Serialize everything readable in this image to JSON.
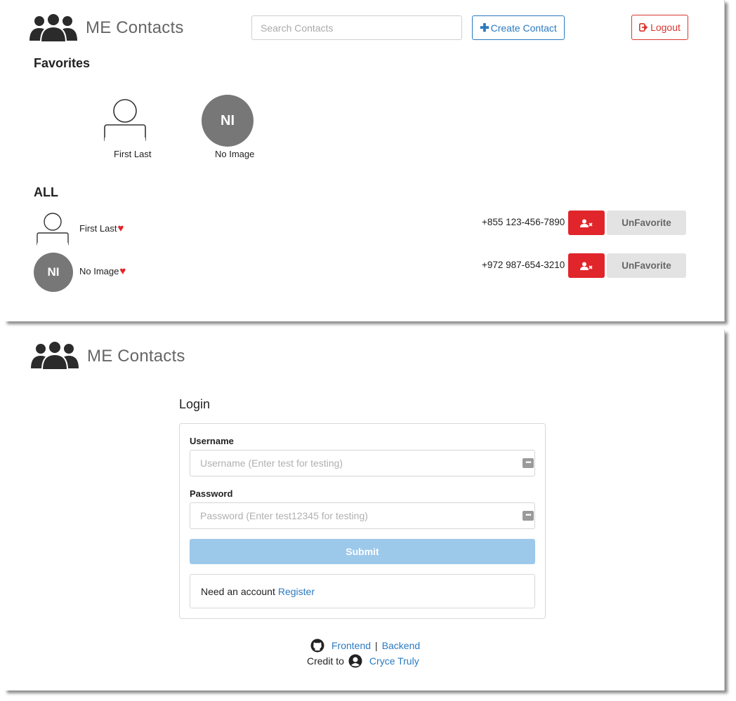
{
  "contacts_view": {
    "app_title": "ME Contacts",
    "search": {
      "placeholder": "Search Contacts"
    },
    "create_button": "Create Contact",
    "logout_button": "Logout",
    "favorites_heading": "Favorites",
    "favorites": [
      {
        "name": "First Last",
        "avatar": "person-outline"
      },
      {
        "name": "No Image",
        "initials": "NI"
      }
    ],
    "all_heading": "ALL",
    "contacts": [
      {
        "name": "First Last",
        "phone": "+855 123-456-7890",
        "favorite": true,
        "unfavorite_label": "UnFavorite",
        "avatar": "person-outline"
      },
      {
        "name": "No Image",
        "phone": "+972 987-654-3210",
        "favorite": true,
        "unfavorite_label": "UnFavorite",
        "initials": "NI"
      }
    ]
  },
  "login_view": {
    "app_title": "ME Contacts",
    "heading": "Login",
    "username_label": "Username",
    "username_placeholder": "Username (Enter test for testing)",
    "password_label": "Password",
    "password_placeholder": "Password (Enter test12345 for testing)",
    "submit_label": "Submit",
    "need_account_text": "Need an account",
    "register_link": "Register",
    "footer": {
      "frontend_link": "Frontend",
      "separator": "|",
      "backend_link": "Backend",
      "credit_text": "Credit to",
      "credit_link": "Cryce Truly"
    }
  },
  "colors": {
    "primary": "#2a7ac0",
    "danger": "#e0262b",
    "muted_button": "#e3e3e3",
    "avatar_gray": "#777777",
    "submit_disabled": "#9cc8ea"
  }
}
